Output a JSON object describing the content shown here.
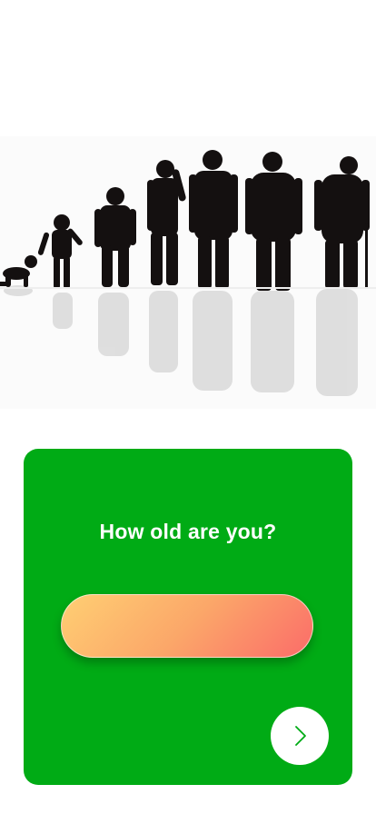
{
  "hero": {
    "image_name": "human-age-progression-silhouettes"
  },
  "card": {
    "question": "How old are you?",
    "background_color": "#00ab15"
  },
  "age_input": {
    "value": "",
    "gradient_colors": [
      "#ffcf73",
      "#fba769",
      "#fb6c69"
    ]
  },
  "next_button": {
    "icon": "chevron-right-icon",
    "icon_color": "#00ab15"
  }
}
